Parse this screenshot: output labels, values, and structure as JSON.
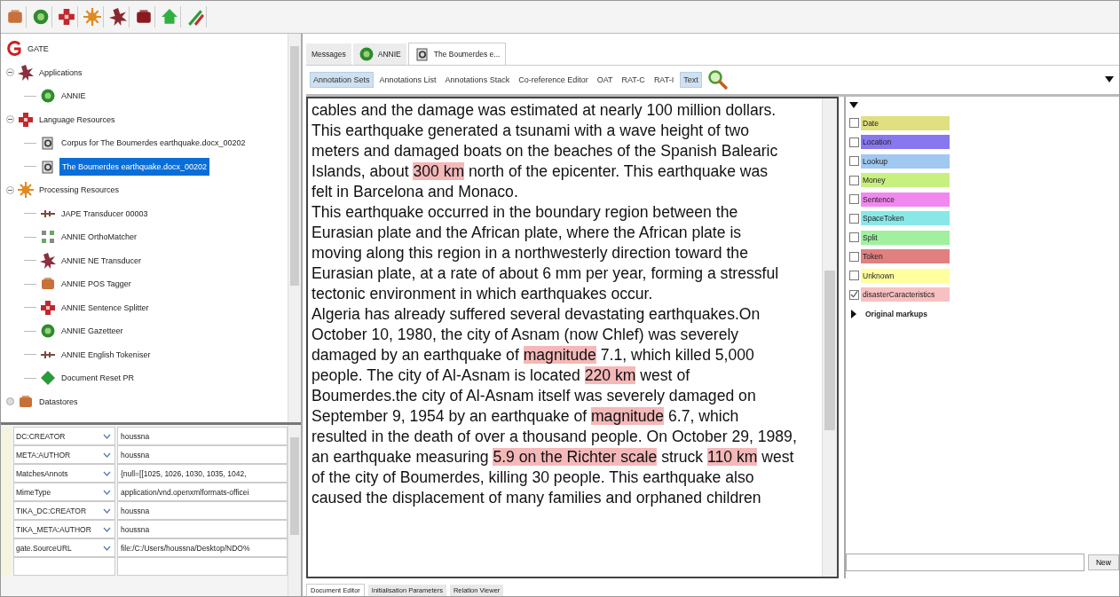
{
  "tree": {
    "label": "GATE",
    "children": [
      {
        "label": "Applications",
        "expanded": true,
        "children": [
          {
            "label": "ANNIE",
            "selected": false
          }
        ]
      },
      {
        "label": "Language Resources",
        "expanded": true,
        "children": [
          {
            "label": "Corpus for The Boumerdes earthquake.docx_00202",
            "selected": false
          },
          {
            "label": "The Boumerdes earthquake.docx_00202",
            "selected": true
          }
        ]
      },
      {
        "label": "Processing Resources",
        "expanded": true,
        "children": [
          {
            "label": "JAPE Transducer 00003",
            "selected": false
          },
          {
            "label": "ANNIE OrthoMatcher",
            "selected": false
          },
          {
            "label": "ANNIE NE Transducer",
            "selected": false
          },
          {
            "label": "ANNIE POS Tagger",
            "selected": false
          },
          {
            "label": "ANNIE Sentence Splitter",
            "selected": false
          },
          {
            "label": "ANNIE Gazetteer",
            "selected": false
          },
          {
            "label": "ANNIE English Tokeniser",
            "selected": false
          },
          {
            "label": "Document Reset PR",
            "selected": false
          }
        ]
      },
      {
        "label": "Datastores",
        "expanded": false
      }
    ]
  },
  "features": [
    {
      "name": "DC:CREATOR",
      "value": "houssna"
    },
    {
      "name": "META:AUTHOR",
      "value": "houssna"
    },
    {
      "name": "MatchesAnnots",
      "value": "{null=[[1025, 1026, 1030, 1035, 1042,"
    },
    {
      "name": "MimeType",
      "value": "application/vnd.openxmlformats-officei"
    },
    {
      "name": "TIKA_DC:CREATOR",
      "value": "houssna"
    },
    {
      "name": "TIKA_META:AUTHOR",
      "value": "houssna"
    },
    {
      "name": "gate.SourceURL",
      "value": "file:/C:/Users/houssna/Desktop/NDO%"
    }
  ],
  "doc_tabs": [
    {
      "label": "Messages",
      "selected": false
    },
    {
      "label": "ANNIE",
      "selected": false
    },
    {
      "label": "The Boumerdes e...",
      "selected": true
    }
  ],
  "view_buttons": [
    {
      "label": "Annotation Sets",
      "selected": true
    },
    {
      "label": "Annotations List",
      "selected": false
    },
    {
      "label": "Annotations Stack",
      "selected": false
    },
    {
      "label": "Co-reference Editor",
      "selected": false
    },
    {
      "label": "OAT",
      "selected": false
    },
    {
      "label": "RAT-C",
      "selected": false
    },
    {
      "label": "RAT-I",
      "selected": false
    },
    {
      "label": "Text",
      "selected": true
    }
  ],
  "text_lines": [
    [
      {
        "text": "cables and the damage was estimated at nearly 100 million dollars.",
        "highlight": false
      }
    ],
    [
      {
        "text": "This earthquake generated a tsunami with a wave height of two",
        "highlight": false
      }
    ],
    [
      {
        "text": "meters and damaged boats on the beaches of the Spanish Balearic",
        "highlight": false
      }
    ],
    [
      {
        "text": "Islands, about ",
        "highlight": false
      },
      {
        "text": "300 km",
        "highlight": true
      },
      {
        "text": " north of the epicenter. This earthquake was",
        "highlight": false
      }
    ],
    [
      {
        "text": "felt in Barcelona and Monaco.",
        "highlight": false
      }
    ],
    [
      {
        "text": "This earthquake occurred in the boundary region between the",
        "highlight": false
      }
    ],
    [
      {
        "text": "Eurasian plate and the African plate, where the African plate is",
        "highlight": false
      }
    ],
    [
      {
        "text": "moving along this region in a northwesterly direction toward the",
        "highlight": false
      }
    ],
    [
      {
        "text": "Eurasian plate, at a rate of about 6 mm per year, forming a stressful",
        "highlight": false
      }
    ],
    [
      {
        "text": "tectonic environment in which earthquakes occur.",
        "highlight": false
      }
    ],
    [
      {
        "text": "Algeria has already suffered several devastating earthquakes.On",
        "highlight": false
      }
    ],
    [
      {
        "text": "October 10, 1980, the city of Asnam (now Chlef) was severely",
        "highlight": false
      }
    ],
    [
      {
        "text": "damaged by an earthquake of ",
        "highlight": false
      },
      {
        "text": "magnitude",
        "highlight": true
      },
      {
        "text": " 7.1, which killed 5,000",
        "highlight": false
      }
    ],
    [
      {
        "text": "people. The city of Al-Asnam is located ",
        "highlight": false
      },
      {
        "text": "220 km",
        "highlight": true
      },
      {
        "text": " west of",
        "highlight": false
      }
    ],
    [
      {
        "text": "Boumerdes.the city of Al-Asnam itself was severely damaged on",
        "highlight": false
      }
    ],
    [
      {
        "text": "September 9, 1954 by an earthquake of ",
        "highlight": false
      },
      {
        "text": "magnitude",
        "highlight": true
      },
      {
        "text": " 6.7, which",
        "highlight": false
      }
    ],
    [
      {
        "text": "resulted in the death of over a thousand people. On October 29, 1989,",
        "highlight": false
      }
    ],
    [
      {
        "text": "an earthquake measuring ",
        "highlight": false
      },
      {
        "text": "5.9 on the Richter scale",
        "highlight": true
      },
      {
        "text": " struck ",
        "highlight": false
      },
      {
        "text": "110 km",
        "highlight": true
      },
      {
        "text": " west",
        "highlight": false
      }
    ],
    [
      {
        "text": "of the city of Boumerdes, killing 30 people. This earthquake also",
        "highlight": false
      }
    ],
    [
      {
        "text": "caused the displacement of many families and orphaned children",
        "highlight": false
      }
    ]
  ],
  "annotation_types": [
    {
      "label": "Date",
      "color": "#e0e080",
      "checked": false
    },
    {
      "label": "Location",
      "color": "#8878f0",
      "checked": false
    },
    {
      "label": "Lookup",
      "color": "#a0c8f0",
      "checked": false
    },
    {
      "label": "Money",
      "color": "#c8f080",
      "checked": false
    },
    {
      "label": "Sentence",
      "color": "#f088f0",
      "checked": false
    },
    {
      "label": "SpaceToken",
      "color": "#88e8e8",
      "checked": false
    },
    {
      "label": "Split",
      "color": "#a0f0a0",
      "checked": false
    },
    {
      "label": "Token",
      "color": "#e08080",
      "checked": false
    },
    {
      "label": "Unknown",
      "color": "#ffffa0",
      "checked": false
    },
    {
      "label": "disasterCaracteristics",
      "color": "#f8c0c0",
      "checked": true
    }
  ],
  "markup_group": {
    "label": "Original markups",
    "expanded": false
  },
  "new_set": {
    "button": "New"
  },
  "bottom_tabs": [
    {
      "label": "Document Editor",
      "selected": true
    },
    {
      "label": "Initialisation Parameters",
      "selected": false
    },
    {
      "label": "Relation Viewer",
      "selected": false
    }
  ]
}
